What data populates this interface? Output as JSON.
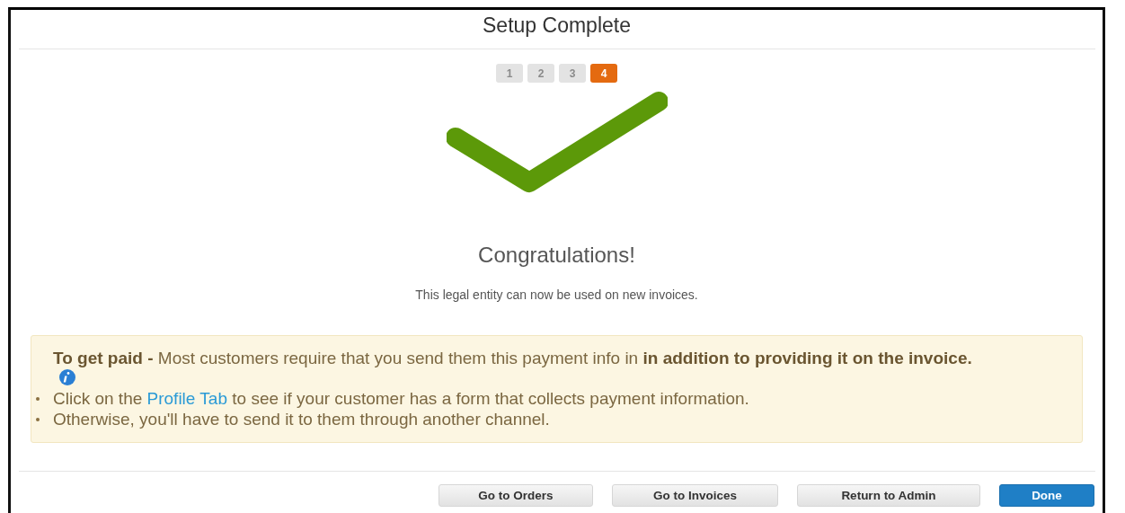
{
  "window": {
    "title": "Setup Complete"
  },
  "steps": [
    {
      "label": "1",
      "selected": false
    },
    {
      "label": "2",
      "selected": false
    },
    {
      "label": "3",
      "selected": false
    },
    {
      "label": "4",
      "selected": true
    }
  ],
  "heading": "Congratulations!",
  "message": "This legal entity can now be used on new invoices.",
  "notice": {
    "text": "**To get paid -** Most customers require that you send them this payment info in **in addition to providing it on the invoice.**",
    "bullets": [
      {
        "before": "Click on the ",
        "link": "Profile Tab",
        "after": " to see if your customer has a form that collects payment information."
      },
      {
        "before": "Otherwise, you'll have to send it to them through another channel."
      }
    ]
  },
  "buttons": [
    {
      "label": "Go to Orders",
      "kind": "default"
    },
    {
      "label": "Go to Invoices",
      "kind": "default"
    },
    {
      "label": "Return to Admin",
      "kind": "default"
    },
    {
      "label": "Done",
      "kind": "primary"
    }
  ]
}
